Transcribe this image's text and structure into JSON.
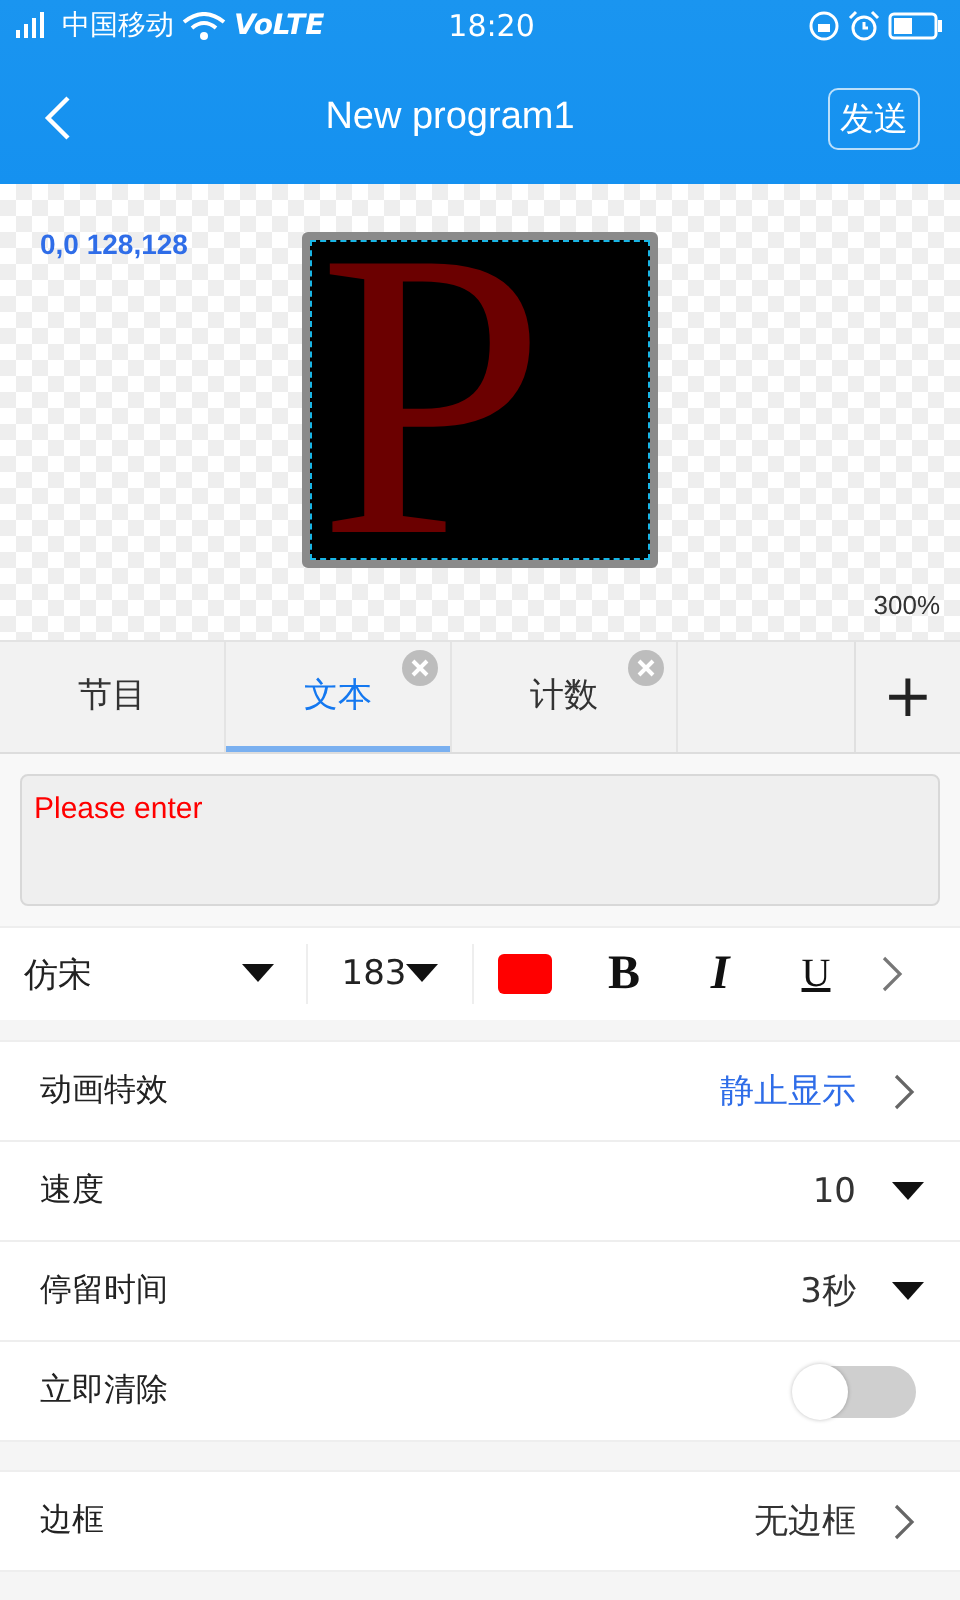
{
  "status_bar": {
    "carrier": "中国移动",
    "network": "VoLTE",
    "time": "18:20"
  },
  "header": {
    "title": "New program1",
    "send_button": "发送"
  },
  "canvas": {
    "coords": "0,0 128,128",
    "preview_letter": "P",
    "zoom": "300%"
  },
  "tabs": [
    {
      "label": "节目",
      "selected": false,
      "closable": false
    },
    {
      "label": "文本",
      "selected": true,
      "closable": true
    },
    {
      "label": "计数",
      "selected": false,
      "closable": true
    }
  ],
  "add_button": "+",
  "text_input": {
    "value": "Please enter"
  },
  "toolbar": {
    "font": "仿宋",
    "size": "183",
    "color": "#ff0000",
    "bold": "B",
    "italic": "I",
    "underline": "U"
  },
  "settings": [
    [
      {
        "kind": "link",
        "label": "动画特效",
        "value": "静止显示",
        "accent": true
      },
      {
        "kind": "dropdown",
        "label": "速度",
        "value": "10"
      },
      {
        "kind": "dropdown",
        "label": "停留时间",
        "value": "3秒"
      },
      {
        "kind": "toggle",
        "label": "立即清除",
        "on": false
      }
    ],
    [
      {
        "kind": "link",
        "label": "边框",
        "value": "无边框",
        "accent": false
      }
    ]
  ]
}
